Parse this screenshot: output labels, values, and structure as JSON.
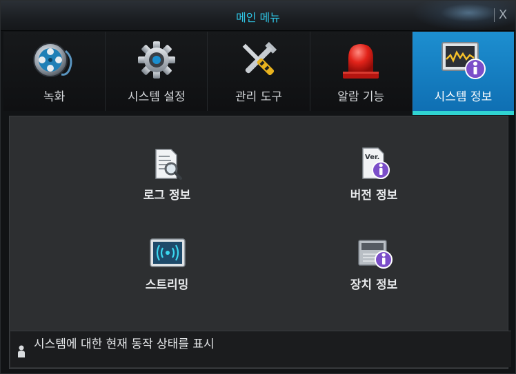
{
  "window": {
    "title": "메인 메뉴",
    "close_label": "X"
  },
  "tabs": [
    {
      "label": "녹화",
      "icon": "film-reel-icon",
      "active": false
    },
    {
      "label": "시스템 설정",
      "icon": "gear-icon",
      "active": false
    },
    {
      "label": "관리 도구",
      "icon": "tools-icon",
      "active": false
    },
    {
      "label": "알람 기능",
      "icon": "alarm-light-icon",
      "active": false
    },
    {
      "label": "시스템 정보",
      "icon": "system-info-icon",
      "active": true
    }
  ],
  "items": [
    {
      "label": "로그 정보",
      "icon": "log-search-icon"
    },
    {
      "label": "버전 정보",
      "icon": "version-info-icon"
    },
    {
      "label": "스트리밍",
      "icon": "streaming-icon"
    },
    {
      "label": "장치 정보",
      "icon": "device-info-icon"
    }
  ],
  "status": {
    "text": "시스템에 대한 현재 동작 상태를 표시",
    "icon": "person-icon"
  },
  "colors": {
    "title": "#2fc6e6",
    "active_tab": "#1d8fd0",
    "active_underline": "#30d4d2",
    "panel": "#2d2f31"
  }
}
